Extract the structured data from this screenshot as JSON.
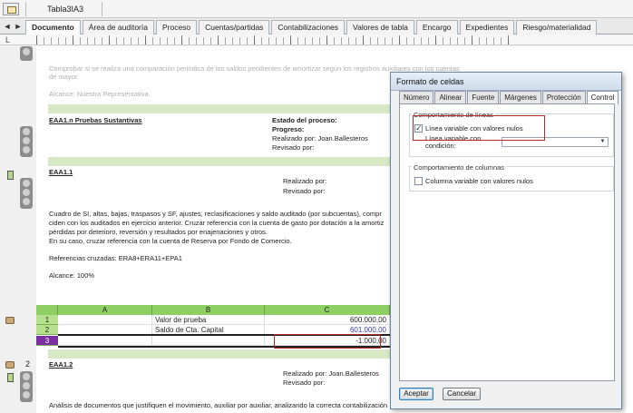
{
  "window": {
    "title": "Tabla3IA3"
  },
  "tabs": [
    {
      "label": "Documento",
      "active": true
    },
    {
      "label": "Área de auditoría"
    },
    {
      "label": "Proceso"
    },
    {
      "label": "Cuentas/partidas"
    },
    {
      "label": "Contabilizaciones"
    },
    {
      "label": "Valores de tabla"
    },
    {
      "label": "Encargo"
    },
    {
      "label": "Expedientes"
    },
    {
      "label": "Riesgo/materialidad"
    }
  ],
  "tab_nav": {
    "prev": "◄",
    "next": "►"
  },
  "ruler": {
    "corner": "L"
  },
  "document": {
    "faded_text_1": "Comprobar si se realiza una comparación periódica de los saldos pendientes de amortizar según los registros auxiliares con los cuentas",
    "faded_text_2": "de mayor.",
    "faded_alcance": "Alcance: Nuestra Representativa.",
    "section1_title": "EAA1.n Pruebas Sustantivas",
    "estado_label": "Estado del proceso:",
    "progreso_label": "Progreso:",
    "realizado1": "Realizado por: Joan.Ballesteros",
    "revisado1": "Revisado por:",
    "section2_title": "EAA1.1",
    "realizado2": "Realizado por:",
    "revisado2": "Revisado por:",
    "para1": "Cuadro de SI, altas, bajas, traspasos y SF, ajustes, reclasificaciones y saldo auditado (por subcuentas), compr",
    "para2": "ciden con los auditados en ejercicio anterior. Cruzar referencia con la cuenta de gasto por dotación a la amortiz",
    "para3": "pérdidas por deterioro, reversión y resultados por enajenaciones y otros.",
    "para4": "En su caso, cruzar referencia con la cuenta de Reserva por Fondo de Comercio.",
    "refs": "Referencias cruzadas: ERA8+ERA11+EPA1",
    "alcance2": "Alcance: 100%",
    "section3_title": "EAA1.2",
    "realizado3": "Realizado por: Joan.Ballesteros",
    "revisado3": "Revisado por:",
    "para_last": "Análisis de documentos que justifiquen el movimiento, auxiliar por auxiliar, analizando la correcta contabilización"
  },
  "gutter": {
    "num1": "1",
    "num2": "2"
  },
  "sheet": {
    "columns": [
      "A",
      "B",
      "C"
    ],
    "rows": [
      {
        "n": "1",
        "b": "Valor de prueba",
        "c": "600.000,00"
      },
      {
        "n": "2",
        "b": "Saldo de Cta. Capital",
        "c": "601.000,00"
      },
      {
        "n": "3",
        "b": "",
        "c": "-1.000,00"
      }
    ]
  },
  "dialog": {
    "title": "Formato de celdas",
    "tabs": [
      "Número",
      "Alinear",
      "Fuente",
      "Márgenes",
      "Protección",
      "Control"
    ],
    "active_tab": "Control",
    "group_lines": "Comportamiento de líneas",
    "chk_linea_nulos": "Línea variable con valores nulos",
    "linea_condicion_1": "Línea variable con",
    "linea_condicion_2": "condición:",
    "group_columns": "Comportamiento de columnas",
    "chk_columna_nulos": "Columna variable con valores nulos",
    "ok": "Aceptar",
    "cancel": "Cancelar"
  },
  "colors": {
    "accent_green": "#8dcf63",
    "highlight_red": "#b42a2a",
    "row_selected": "#7a2fa0"
  }
}
